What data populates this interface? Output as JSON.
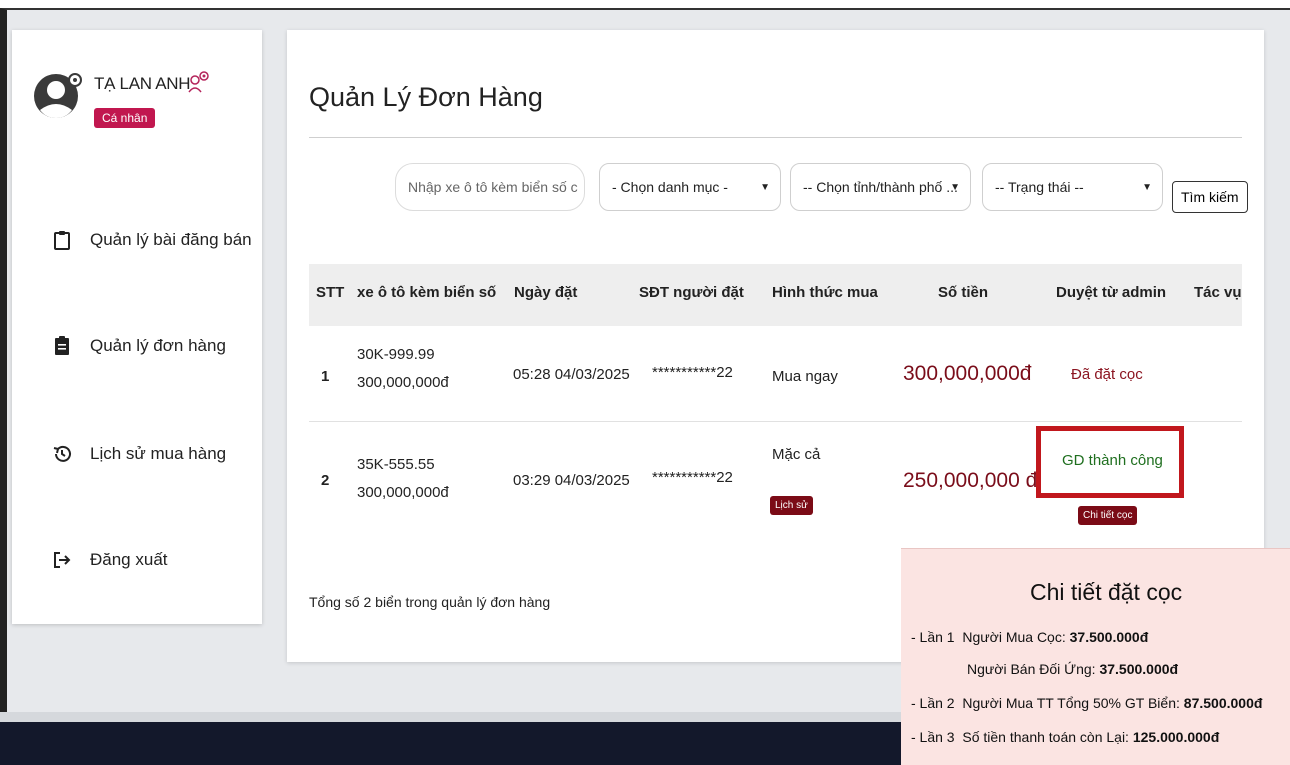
{
  "user": {
    "name": "TẠ LAN ANH",
    "role_badge": "Cá nhân"
  },
  "sidebar": {
    "items": [
      {
        "label": "Quản lý bài đăng bán",
        "icon": "clipboard-icon"
      },
      {
        "label": "Quản lý đơn hàng",
        "icon": "clipboard-list-icon"
      },
      {
        "label": "Lịch sử mua hàng",
        "icon": "history-icon"
      },
      {
        "label": "Đăng xuất",
        "icon": "logout-icon"
      }
    ]
  },
  "main": {
    "title": "Quản Lý Đơn Hàng",
    "filters": {
      "search_placeholder": "Nhập xe ô tô kèm biển số c",
      "category": "- Chọn danh mục -",
      "city": "-- Chọn tỉnh/thành phố ...",
      "status": "-- Trạng thái --",
      "search_button": "Tìm kiếm"
    },
    "table": {
      "headers": [
        "STT",
        "xe ô tô kèm biển số",
        "Ngày đặt",
        "SĐT người đặt",
        "Hình thức mua",
        "Số tiền",
        "Duyệt từ admin",
        "Tác vụ"
      ],
      "rows": [
        {
          "stt": "1",
          "plate": "30K-999.99",
          "plate_price": "300,000,000đ",
          "date": "05:28 04/03/2025",
          "phone": "***********22",
          "purchase_type": "Mua ngay",
          "amount": "300,000,000đ",
          "admin_status": "Đã đặt cọc"
        },
        {
          "stt": "2",
          "plate": "35K-555.55",
          "plate_price": "300,000,000đ",
          "date": "03:29 04/03/2025",
          "phone": "***********22",
          "purchase_type": "Mặc cả",
          "history_button": "Lịch sử",
          "amount": "250,000,000 đ",
          "admin_status": "GD thành công",
          "detail_button": "Chi tiết cọc"
        }
      ]
    },
    "footer_count": "Tổng số 2 biển trong quản lý đơn hàng"
  },
  "deposit_popup": {
    "title": "Chi tiết đặt cọc",
    "lines": [
      {
        "prefix": "- Lần 1",
        "label": "Người Mua Cọc:",
        "value": "37.500.000đ"
      },
      {
        "prefix": "",
        "label": "Người Bán Đối Ứng:",
        "value": "37.500.000đ"
      },
      {
        "prefix": "- Lần 2",
        "label": "Người Mua TT Tổng 50% GT Biển:",
        "value": "87.500.000đ"
      },
      {
        "prefix": "- Lần 3",
        "label": "Số tiền thanh toán còn Lại:",
        "value": "125.000.000đ"
      }
    ]
  },
  "colors": {
    "accent_badge": "#c1174f",
    "amount": "#7a0d1a",
    "success": "#1f6f1f",
    "highlight": "#c1171d",
    "popup_bg": "#fbe4e2"
  }
}
